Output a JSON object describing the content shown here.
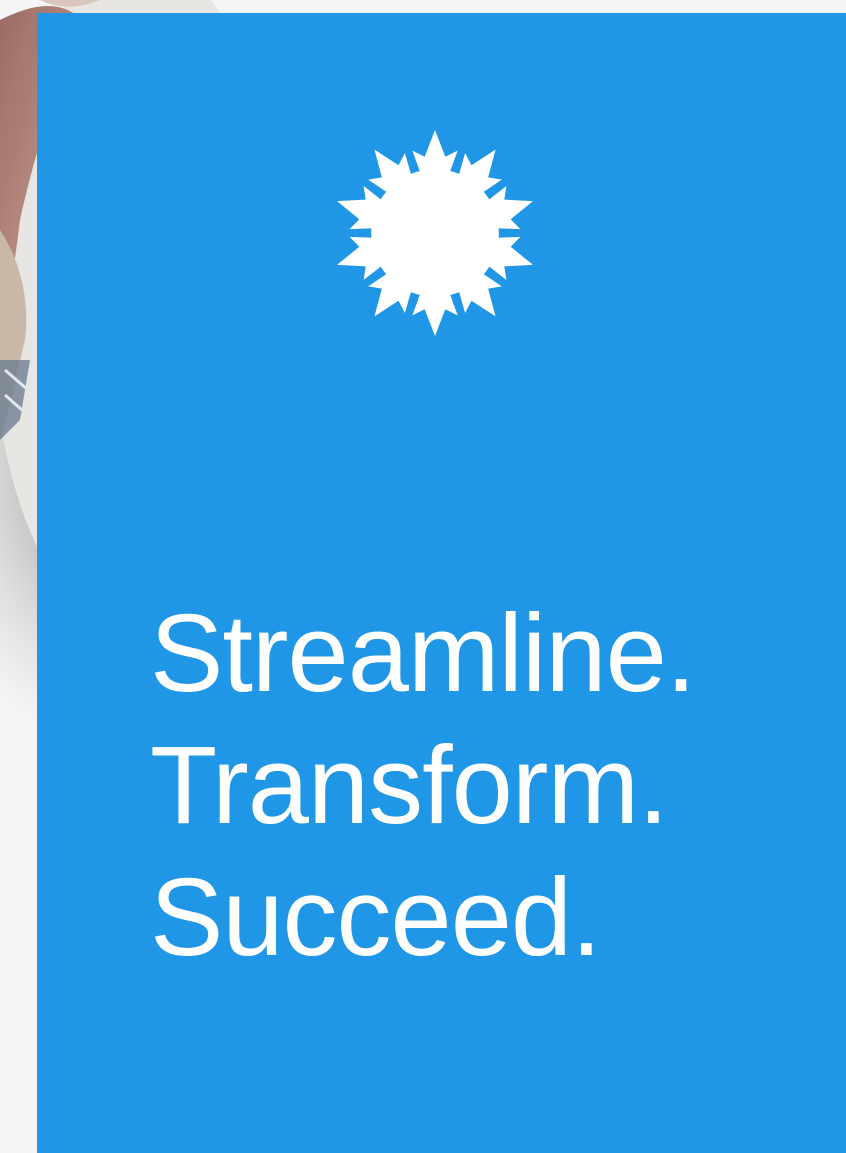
{
  "colors": {
    "panel_background": "#2097e6",
    "text": "#ffffff",
    "page_background": "#f5f5f5"
  },
  "logo": {
    "icon": "snowflake-icon",
    "color": "#ffffff"
  },
  "tagline": {
    "line1": "Streamline.",
    "line2": "Transform.",
    "line3": "Succeed."
  }
}
